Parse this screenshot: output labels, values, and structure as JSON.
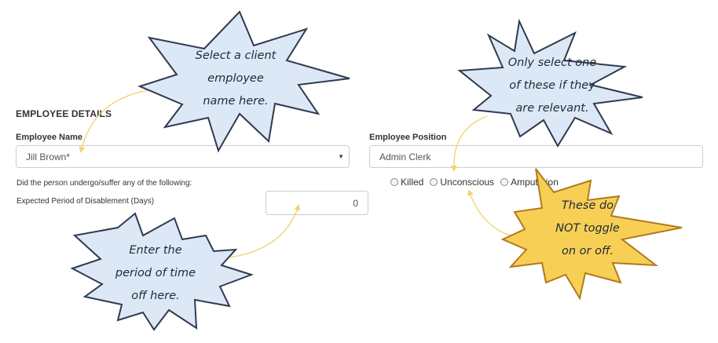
{
  "form": {
    "section_title": "EMPLOYEE DETAILS",
    "employee_name_label": "Employee Name",
    "employee_name_value": "Jill Brown*",
    "employee_position_label": "Employee Position",
    "employee_position_value": "Admin Clerk",
    "question_text": "Did the person undergo/suffer any of the following:",
    "disablement_label": "Expected Period of Disablement (Days)",
    "disablement_value": "0",
    "radio_options": [
      "Killed",
      "Unconscious",
      "Amputation"
    ]
  },
  "callouts": {
    "name": [
      "Select a client",
      "employee",
      "name here."
    ],
    "position": [
      "Only select one",
      "of these if they",
      "are relevant."
    ],
    "period": [
      "Enter the",
      "period of time",
      "off here."
    ],
    "toggle": [
      "These do",
      "NOT toggle",
      "on or off."
    ]
  },
  "colors": {
    "callout_blue_fill": "#dce8f5",
    "callout_yellow_fill": "#f8cf55",
    "callout_stroke": "#2f3a4f",
    "arrow_yellow": "#f2d36b",
    "input_border": "#cccccc"
  },
  "icons": {
    "select_caret": "caret-down-icon"
  }
}
